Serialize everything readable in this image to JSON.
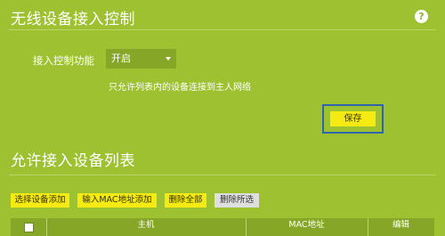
{
  "colors": {
    "background": "#9dc130",
    "accent_button": "#f5ea12",
    "secondary_button": "#dedede",
    "highlight_border": "#2f65ad",
    "table_header": "#85a626"
  },
  "access_control": {
    "title": "无线设备接入控制",
    "help_icon": "help-circle-icon",
    "help_text": "?",
    "function_label": "接入控制功能",
    "function_value": "开启",
    "hint": "只允许列表内的设备连接到主人网络",
    "save_label": "保存"
  },
  "allow_list": {
    "title": "允许接入设备列表",
    "buttons": {
      "select_add": "选择设备添加",
      "input_mac_add": "输入MAC地址添加",
      "delete_all": "删除全部",
      "delete_selected": "删除所选"
    },
    "columns": {
      "host": "主机",
      "mac": "MAC地址",
      "edit": "编辑"
    }
  }
}
